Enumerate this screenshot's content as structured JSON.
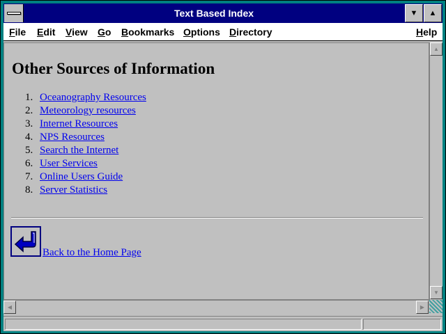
{
  "window": {
    "title": "Text Based Index"
  },
  "menubar": {
    "items": [
      {
        "label": "File",
        "key": "F",
        "rest": "ile"
      },
      {
        "label": "Edit",
        "key": "E",
        "rest": "dit"
      },
      {
        "label": "View",
        "key": "V",
        "rest": "iew"
      },
      {
        "label": "Go",
        "key": "G",
        "rest": "o"
      },
      {
        "label": "Bookmarks",
        "key": "B",
        "rest": "ookmarks"
      },
      {
        "label": "Options",
        "key": "O",
        "rest": "ptions"
      },
      {
        "label": "Directory",
        "key": "D",
        "rest": "irectory"
      },
      {
        "label": "Help",
        "key": "H",
        "rest": "elp"
      }
    ]
  },
  "page": {
    "heading": "Other Sources of Information",
    "links": [
      {
        "num": "1.",
        "label": "Oceanography Resources "
      },
      {
        "num": "2.",
        "label": "Meteorology resources"
      },
      {
        "num": "3.",
        "label": "Internet Resources"
      },
      {
        "num": "4.",
        "label": "NPS Resources "
      },
      {
        "num": "5.",
        "label": "Search the Internet "
      },
      {
        "num": "6.",
        "label": "User Services "
      },
      {
        "num": "7.",
        "label": "Online Users Guide "
      },
      {
        "num": "8.",
        "label": "Server Statistics "
      }
    ],
    "home_link": "Back to the Home Page "
  },
  "colors": {
    "titlebar": "#000080",
    "link": "#0000ee",
    "frame": "#008080"
  }
}
